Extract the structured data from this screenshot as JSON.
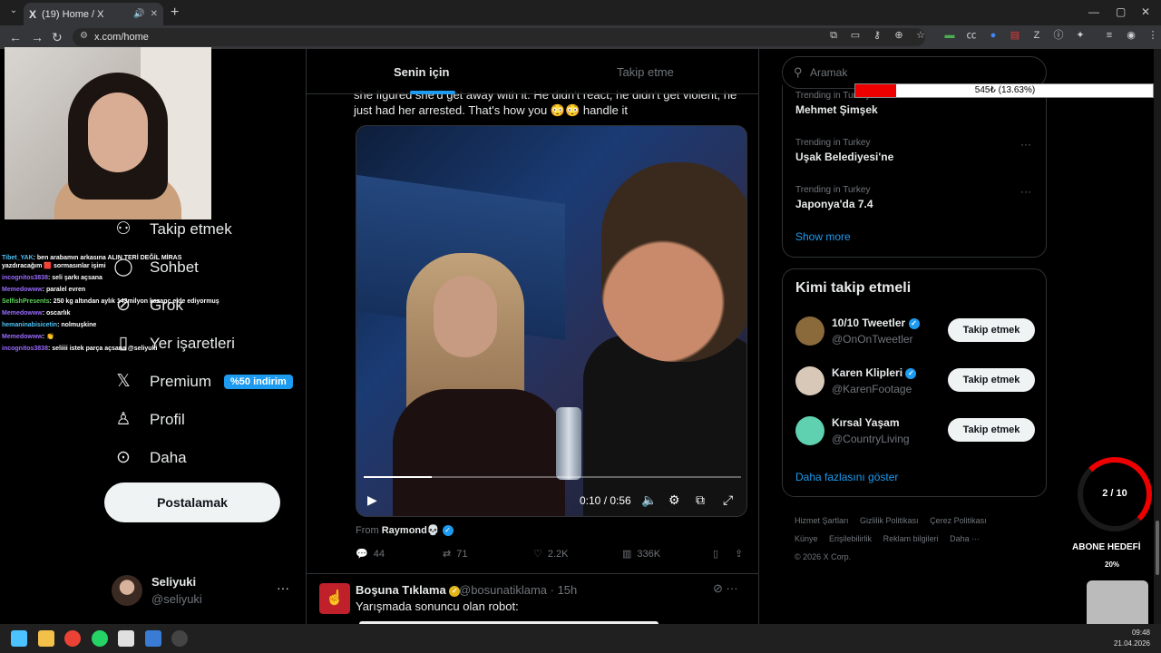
{
  "browser": {
    "tab_title": "(19) Home / X",
    "tab_logo": "X",
    "url": "x.com/home",
    "new_tab": "+",
    "tab_close": "✕",
    "tab_audio": "🔊"
  },
  "nav": {
    "items": [
      {
        "label": "Takip etmek",
        "icon": "follow-icon",
        "glyph": "⚇"
      },
      {
        "label": "Sohbet",
        "icon": "chat-icon",
        "glyph": "◯"
      },
      {
        "label": "Grok",
        "icon": "grok-icon",
        "glyph": "⊘"
      },
      {
        "label": "Yer işaretleri",
        "icon": "bookmark-icon",
        "glyph": "▯"
      },
      {
        "label": "Premium",
        "icon": "x-premium-icon",
        "glyph": "𝕏"
      },
      {
        "label": "Profil",
        "icon": "profile-icon",
        "glyph": "♙"
      },
      {
        "label": "Daha",
        "icon": "more-icon",
        "glyph": "⊙"
      }
    ],
    "partial_labels": [
      "k",
      "r"
    ],
    "premium_badge": "%50 indirim",
    "post_button": "Postalamak",
    "account": {
      "name": "Seliyuki",
      "handle": "@seliyuki",
      "more": "···"
    }
  },
  "timeline": {
    "tabs": [
      "Senin için",
      "Takip etme"
    ],
    "tweet1": {
      "text": "she figured she'd get away with it. He didn't react, he didn't get violent, he just had her arrested. That's how you 😳😳 handle it",
      "video_time": "0:10 / 0:56",
      "video_progress": 0.18,
      "from_label": "From",
      "from_name": "Raymond💀",
      "replies": "44",
      "reposts": "71",
      "likes": "2.2K",
      "views": "336K"
    },
    "tweet2": {
      "name": "Boşuna Tıklama",
      "handle": "@bosunatiklama · 15h",
      "text": "Yarışmada sonuncu olan robot:",
      "more": "···"
    }
  },
  "right": {
    "search_placeholder": "Aramak",
    "trends": [
      {
        "meta": "Trending in Turkey",
        "title": "Mehmet Şimşek"
      },
      {
        "meta": "Trending in Turkey",
        "title": "Uşak Belediyesi'ne"
      },
      {
        "meta": "Trending in Turkey",
        "title": "Japonya'da 7.4"
      }
    ],
    "trend_more": "···",
    "show_more": "Show more",
    "who_title": "Kimi takip etmeli",
    "who": [
      {
        "name": "10/10 Tweetler",
        "handle": "@OnOnTweetler",
        "button": "Takip etmek",
        "color": "#8a6a3a"
      },
      {
        "name": "Karen Klipleri",
        "handle": "@KarenFootage",
        "button": "Takip etmek",
        "color": "#d8c8b8"
      },
      {
        "name": "Kırsal Yaşam",
        "handle": "@CountryLiving",
        "button": "Takip etmek",
        "color": "#5fd1b0"
      }
    ],
    "who_more": "Daha fazlasını göster",
    "footer": [
      "Hizmet Şartları",
      "Gizlilik Politikası",
      "Çerez Politikası",
      "Künye",
      "Erişilebilirlik",
      "Reklam bilgileri",
      "Daha ···",
      "© 2026 X Corp."
    ]
  },
  "overlays": {
    "donation_label": "545₺ (13.63%)",
    "donation_progress": 0.1363,
    "goal_count": "2 / 10",
    "goal_label": "ABONE HEDEFİ",
    "goal_pct": "20%",
    "chat": [
      {
        "user": "Tibet_YAK",
        "msg": ": ben arabamın arkasına ALIN TERİ DEĞİL MİRAS yazdıracağım 🟥 sormasınlar işimi",
        "cls": "c"
      },
      {
        "user": "incognitos3838",
        "msg": ": seli şarkı açsana",
        "cls": ""
      },
      {
        "user": "Memedowww",
        "msg": ": paralel evren",
        "cls": ""
      },
      {
        "user": "SelfishPresents",
        "msg": ": 250 kg altından aylık 143milyon kazanç elde ediyormuş",
        "cls": "g"
      },
      {
        "user": "Memedowww",
        "msg": ": oscarlık",
        "cls": ""
      },
      {
        "user": "hemaninabisicetin",
        "msg": ": nolmuşkine",
        "cls": "c"
      },
      {
        "user": "Memedowww",
        "msg": ": 👏",
        "cls": ""
      },
      {
        "user": "incognitos3838",
        "msg": ": seliiii istek parça açsana @seliyuki",
        "cls": ""
      }
    ]
  },
  "taskbar": {
    "time": "09:48",
    "date": "21.04.2026"
  }
}
